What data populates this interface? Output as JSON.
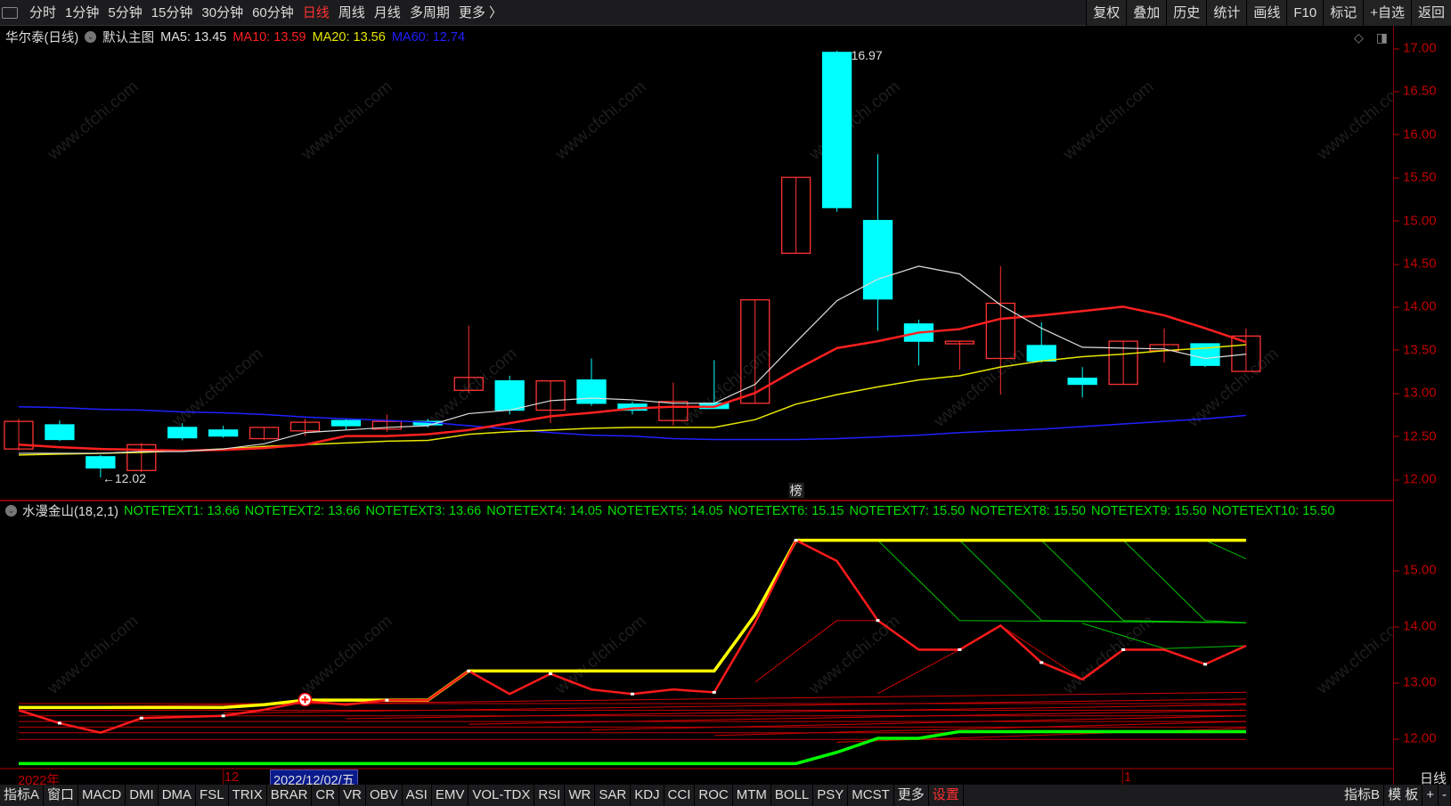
{
  "toolbar": {
    "periods": [
      "分时",
      "1分钟",
      "5分钟",
      "15分钟",
      "30分钟",
      "60分钟",
      "日线",
      "周线",
      "月线",
      "多周期",
      "更多 〉"
    ],
    "active_period": "日线",
    "right": [
      "复权",
      "叠加",
      "历史",
      "统计",
      "画线",
      "F10",
      "标记",
      "+自选",
      "返回"
    ]
  },
  "info": {
    "stock": "华尔泰(日线)",
    "template": "默认主图",
    "ma5": "MA5: 13.45",
    "ma10": "MA10: 13.59",
    "ma20": "MA20: 13.56",
    "ma60": "MA60: 12.74"
  },
  "indicator": {
    "name": "水漫金山(18,2,1)",
    "notes": [
      "NOTETEXT1: 13.66",
      "NOTETEXT2: 13.66",
      "NOTETEXT3: 13.66",
      "NOTETEXT4: 14.05",
      "NOTETEXT5: 14.05",
      "NOTETEXT6: 15.15",
      "NOTETEXT7: 15.50",
      "NOTETEXT8: 15.50",
      "NOTETEXT9: 15.50",
      "NOTETEXT10: 15.50"
    ]
  },
  "annotations": {
    "high": "16.97",
    "low": "←12.02",
    "marker": "榜"
  },
  "date_axis": {
    "year": "2022年",
    "month12": "12",
    "selected": "2022/12/02/五",
    "month1": "1",
    "period": "日线"
  },
  "bottombar": {
    "left": [
      "指标A",
      "窗口",
      "MACD",
      "DMI",
      "DMA",
      "FSL",
      "TRIX",
      "BRAR",
      "CR",
      "VR",
      "OBV",
      "ASI",
      "EMV",
      "VOL-TDX",
      "RSI",
      "WR",
      "SAR",
      "KDJ",
      "CCI",
      "ROC",
      "MTM",
      "BOLL",
      "PSY",
      "MCST",
      "更多",
      "设置"
    ],
    "right": [
      "指标B",
      "模 板",
      "+",
      "-"
    ]
  },
  "watermark": "www.cfchi.com",
  "colors": {
    "up": "#ff3232",
    "down": "#00ffff",
    "ma5": "#e0e0e0",
    "ma10": "#ff2020",
    "ma20": "#e6e600",
    "ma60": "#2020ff",
    "axis": "#c00000"
  },
  "chart_data": [
    {
      "type": "candlestick",
      "title": "华尔泰(日线)",
      "ylim": [
        11.9,
        17.1
      ],
      "yticks": [
        "17.00",
        "16.50",
        "16.00",
        "15.50",
        "15.00",
        "14.50",
        "14.00",
        "13.50",
        "13.00",
        "12.50",
        "12.00"
      ],
      "ohlc": [
        [
          12.35,
          12.7,
          12.33,
          12.67
        ],
        [
          12.63,
          12.68,
          12.44,
          12.46
        ],
        [
          12.26,
          12.28,
          12.02,
          12.13
        ],
        [
          12.1,
          12.42,
          12.08,
          12.4
        ],
        [
          12.6,
          12.65,
          12.45,
          12.48
        ],
        [
          12.57,
          12.62,
          12.48,
          12.5
        ],
        [
          12.47,
          12.6,
          12.45,
          12.6
        ],
        [
          12.56,
          12.7,
          12.5,
          12.66
        ],
        [
          12.68,
          12.7,
          12.57,
          12.62
        ],
        [
          12.58,
          12.75,
          12.55,
          12.67
        ],
        [
          12.67,
          12.7,
          12.6,
          12.63
        ],
        [
          13.03,
          13.78,
          13.0,
          13.18
        ],
        [
          13.14,
          13.2,
          12.75,
          12.8
        ],
        [
          12.8,
          13.14,
          12.65,
          13.14
        ],
        [
          13.15,
          13.4,
          12.85,
          12.88
        ],
        [
          12.87,
          12.9,
          12.75,
          12.8
        ],
        [
          12.68,
          13.12,
          12.62,
          12.9
        ],
        [
          12.88,
          13.38,
          12.82,
          12.82
        ],
        [
          12.88,
          14.08,
          12.88,
          14.08
        ],
        [
          14.62,
          15.5,
          14.62,
          15.5
        ],
        [
          16.95,
          16.97,
          15.1,
          15.15
        ],
        [
          15.0,
          15.77,
          13.72,
          14.09
        ],
        [
          13.8,
          13.85,
          13.32,
          13.6
        ],
        [
          13.57,
          13.6,
          13.27,
          13.6
        ],
        [
          13.4,
          14.47,
          12.98,
          14.04
        ],
        [
          13.55,
          13.82,
          13.35,
          13.37
        ],
        [
          13.17,
          13.3,
          12.95,
          13.1
        ],
        [
          13.1,
          13.6,
          13.1,
          13.6
        ],
        [
          13.49,
          13.75,
          13.35,
          13.56
        ],
        [
          13.57,
          13.57,
          13.3,
          13.32
        ],
        [
          13.25,
          13.75,
          13.25,
          13.66
        ]
      ],
      "ma5": [
        12.3,
        12.3,
        12.3,
        12.32,
        12.32,
        12.35,
        12.41,
        12.54,
        12.57,
        12.6,
        12.62,
        12.76,
        12.8,
        12.91,
        12.94,
        12.92,
        12.88,
        12.88,
        13.1,
        13.59,
        14.07,
        14.32,
        14.47,
        14.38,
        14.02,
        13.75,
        13.53,
        13.52,
        13.51,
        13.4,
        13.45
      ],
      "ma10": [
        12.4,
        12.37,
        12.35,
        12.34,
        12.33,
        12.34,
        12.36,
        12.4,
        12.5,
        12.5,
        12.52,
        12.57,
        12.65,
        12.73,
        12.77,
        12.82,
        12.84,
        12.84,
        13.0,
        13.27,
        13.52,
        13.6,
        13.7,
        13.74,
        13.86,
        13.9,
        13.95,
        14.0,
        13.9,
        13.75,
        13.59
      ],
      "ma20": [
        12.28,
        12.29,
        12.3,
        12.31,
        12.33,
        12.35,
        12.38,
        12.4,
        12.42,
        12.44,
        12.45,
        12.52,
        12.55,
        12.57,
        12.59,
        12.6,
        12.6,
        12.6,
        12.69,
        12.87,
        12.98,
        13.07,
        13.15,
        13.2,
        13.3,
        13.37,
        13.42,
        13.45,
        13.49,
        13.52,
        13.56
      ],
      "ma60": [
        12.84,
        12.83,
        12.81,
        12.8,
        12.78,
        12.77,
        12.75,
        12.72,
        12.7,
        12.68,
        12.66,
        12.62,
        12.58,
        12.54,
        12.51,
        12.5,
        12.47,
        12.46,
        12.46,
        12.46,
        12.47,
        12.49,
        12.51,
        12.54,
        12.56,
        12.58,
        12.61,
        12.64,
        12.67,
        12.7,
        12.74
      ]
    },
    {
      "type": "line",
      "title": "水漫金山(18,2,1)",
      "ylim": [
        11.5,
        15.65
      ],
      "yticks": [
        "15.00",
        "14.00",
        "13.00",
        "12.00"
      ],
      "upper": [
        12.55,
        12.55,
        12.55,
        12.55,
        12.55,
        12.55,
        12.6,
        12.68,
        12.68,
        12.68,
        12.68,
        13.2,
        13.2,
        13.2,
        13.2,
        13.2,
        13.2,
        13.2,
        14.2,
        15.53,
        15.53,
        15.53,
        15.53,
        15.53,
        15.53,
        15.53,
        15.53,
        15.53,
        15.53,
        15.53,
        15.53
      ],
      "main": [
        12.5,
        12.27,
        12.1,
        12.36,
        12.38,
        12.4,
        12.51,
        12.66,
        12.6,
        12.68,
        12.68,
        13.2,
        12.79,
        13.15,
        12.87,
        12.79,
        12.87,
        12.82,
        14.06,
        15.53,
        15.16,
        14.1,
        13.58,
        13.58,
        14.01,
        13.35,
        13.05,
        13.58,
        13.58,
        13.32,
        13.65
      ],
      "lower": [
        11.55,
        11.55,
        11.55,
        11.55,
        11.55,
        11.55,
        11.55,
        11.55,
        11.55,
        11.55,
        11.55,
        11.55,
        11.55,
        11.55,
        11.55,
        11.55,
        11.55,
        11.55,
        11.55,
        11.55,
        11.75,
        12.0,
        12.0,
        12.12,
        12.12,
        12.12,
        12.12,
        12.12,
        12.12,
        12.12,
        12.12
      ],
      "green_fans": [
        [
          21,
          15.53,
          23,
          14.1,
          30,
          14.06
        ],
        [
          23,
          15.53,
          25,
          14.1,
          30,
          14.06
        ],
        [
          25,
          15.53,
          27,
          14.1,
          30,
          14.06
        ],
        [
          27,
          15.53,
          29,
          14.1,
          30,
          14.06
        ],
        [
          29,
          15.53,
          30,
          15.2
        ],
        [
          26,
          14.05,
          28,
          13.6,
          30,
          13.65
        ]
      ],
      "red_levels": [
        12.82,
        12.7,
        12.6,
        12.5,
        12.4,
        12.3,
        12.18
      ]
    }
  ]
}
